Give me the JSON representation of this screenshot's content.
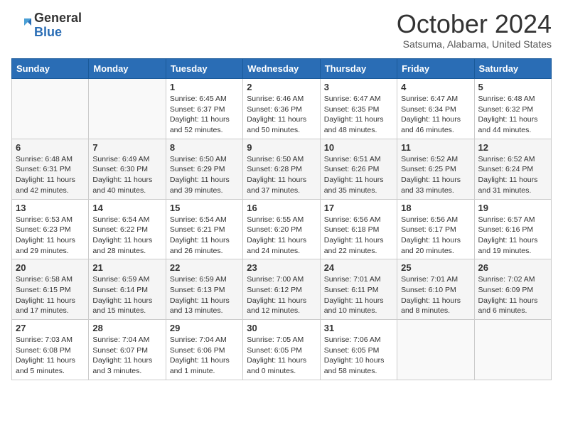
{
  "header": {
    "logo_general": "General",
    "logo_blue": "Blue",
    "month_title": "October 2024",
    "location": "Satsuma, Alabama, United States"
  },
  "days_of_week": [
    "Sunday",
    "Monday",
    "Tuesday",
    "Wednesday",
    "Thursday",
    "Friday",
    "Saturday"
  ],
  "weeks": [
    [
      {
        "day": "",
        "sunrise": "",
        "sunset": "",
        "daylight": ""
      },
      {
        "day": "",
        "sunrise": "",
        "sunset": "",
        "daylight": ""
      },
      {
        "day": "1",
        "sunrise": "Sunrise: 6:45 AM",
        "sunset": "Sunset: 6:37 PM",
        "daylight": "Daylight: 11 hours and 52 minutes."
      },
      {
        "day": "2",
        "sunrise": "Sunrise: 6:46 AM",
        "sunset": "Sunset: 6:36 PM",
        "daylight": "Daylight: 11 hours and 50 minutes."
      },
      {
        "day": "3",
        "sunrise": "Sunrise: 6:47 AM",
        "sunset": "Sunset: 6:35 PM",
        "daylight": "Daylight: 11 hours and 48 minutes."
      },
      {
        "day": "4",
        "sunrise": "Sunrise: 6:47 AM",
        "sunset": "Sunset: 6:34 PM",
        "daylight": "Daylight: 11 hours and 46 minutes."
      },
      {
        "day": "5",
        "sunrise": "Sunrise: 6:48 AM",
        "sunset": "Sunset: 6:32 PM",
        "daylight": "Daylight: 11 hours and 44 minutes."
      }
    ],
    [
      {
        "day": "6",
        "sunrise": "Sunrise: 6:48 AM",
        "sunset": "Sunset: 6:31 PM",
        "daylight": "Daylight: 11 hours and 42 minutes."
      },
      {
        "day": "7",
        "sunrise": "Sunrise: 6:49 AM",
        "sunset": "Sunset: 6:30 PM",
        "daylight": "Daylight: 11 hours and 40 minutes."
      },
      {
        "day": "8",
        "sunrise": "Sunrise: 6:50 AM",
        "sunset": "Sunset: 6:29 PM",
        "daylight": "Daylight: 11 hours and 39 minutes."
      },
      {
        "day": "9",
        "sunrise": "Sunrise: 6:50 AM",
        "sunset": "Sunset: 6:28 PM",
        "daylight": "Daylight: 11 hours and 37 minutes."
      },
      {
        "day": "10",
        "sunrise": "Sunrise: 6:51 AM",
        "sunset": "Sunset: 6:26 PM",
        "daylight": "Daylight: 11 hours and 35 minutes."
      },
      {
        "day": "11",
        "sunrise": "Sunrise: 6:52 AM",
        "sunset": "Sunset: 6:25 PM",
        "daylight": "Daylight: 11 hours and 33 minutes."
      },
      {
        "day": "12",
        "sunrise": "Sunrise: 6:52 AM",
        "sunset": "Sunset: 6:24 PM",
        "daylight": "Daylight: 11 hours and 31 minutes."
      }
    ],
    [
      {
        "day": "13",
        "sunrise": "Sunrise: 6:53 AM",
        "sunset": "Sunset: 6:23 PM",
        "daylight": "Daylight: 11 hours and 29 minutes."
      },
      {
        "day": "14",
        "sunrise": "Sunrise: 6:54 AM",
        "sunset": "Sunset: 6:22 PM",
        "daylight": "Daylight: 11 hours and 28 minutes."
      },
      {
        "day": "15",
        "sunrise": "Sunrise: 6:54 AM",
        "sunset": "Sunset: 6:21 PM",
        "daylight": "Daylight: 11 hours and 26 minutes."
      },
      {
        "day": "16",
        "sunrise": "Sunrise: 6:55 AM",
        "sunset": "Sunset: 6:20 PM",
        "daylight": "Daylight: 11 hours and 24 minutes."
      },
      {
        "day": "17",
        "sunrise": "Sunrise: 6:56 AM",
        "sunset": "Sunset: 6:18 PM",
        "daylight": "Daylight: 11 hours and 22 minutes."
      },
      {
        "day": "18",
        "sunrise": "Sunrise: 6:56 AM",
        "sunset": "Sunset: 6:17 PM",
        "daylight": "Daylight: 11 hours and 20 minutes."
      },
      {
        "day": "19",
        "sunrise": "Sunrise: 6:57 AM",
        "sunset": "Sunset: 6:16 PM",
        "daylight": "Daylight: 11 hours and 19 minutes."
      }
    ],
    [
      {
        "day": "20",
        "sunrise": "Sunrise: 6:58 AM",
        "sunset": "Sunset: 6:15 PM",
        "daylight": "Daylight: 11 hours and 17 minutes."
      },
      {
        "day": "21",
        "sunrise": "Sunrise: 6:59 AM",
        "sunset": "Sunset: 6:14 PM",
        "daylight": "Daylight: 11 hours and 15 minutes."
      },
      {
        "day": "22",
        "sunrise": "Sunrise: 6:59 AM",
        "sunset": "Sunset: 6:13 PM",
        "daylight": "Daylight: 11 hours and 13 minutes."
      },
      {
        "day": "23",
        "sunrise": "Sunrise: 7:00 AM",
        "sunset": "Sunset: 6:12 PM",
        "daylight": "Daylight: 11 hours and 12 minutes."
      },
      {
        "day": "24",
        "sunrise": "Sunrise: 7:01 AM",
        "sunset": "Sunset: 6:11 PM",
        "daylight": "Daylight: 11 hours and 10 minutes."
      },
      {
        "day": "25",
        "sunrise": "Sunrise: 7:01 AM",
        "sunset": "Sunset: 6:10 PM",
        "daylight": "Daylight: 11 hours and 8 minutes."
      },
      {
        "day": "26",
        "sunrise": "Sunrise: 7:02 AM",
        "sunset": "Sunset: 6:09 PM",
        "daylight": "Daylight: 11 hours and 6 minutes."
      }
    ],
    [
      {
        "day": "27",
        "sunrise": "Sunrise: 7:03 AM",
        "sunset": "Sunset: 6:08 PM",
        "daylight": "Daylight: 11 hours and 5 minutes."
      },
      {
        "day": "28",
        "sunrise": "Sunrise: 7:04 AM",
        "sunset": "Sunset: 6:07 PM",
        "daylight": "Daylight: 11 hours and 3 minutes."
      },
      {
        "day": "29",
        "sunrise": "Sunrise: 7:04 AM",
        "sunset": "Sunset: 6:06 PM",
        "daylight": "Daylight: 11 hours and 1 minute."
      },
      {
        "day": "30",
        "sunrise": "Sunrise: 7:05 AM",
        "sunset": "Sunset: 6:05 PM",
        "daylight": "Daylight: 11 hours and 0 minutes."
      },
      {
        "day": "31",
        "sunrise": "Sunrise: 7:06 AM",
        "sunset": "Sunset: 6:05 PM",
        "daylight": "Daylight: 10 hours and 58 minutes."
      },
      {
        "day": "",
        "sunrise": "",
        "sunset": "",
        "daylight": ""
      },
      {
        "day": "",
        "sunrise": "",
        "sunset": "",
        "daylight": ""
      }
    ]
  ]
}
